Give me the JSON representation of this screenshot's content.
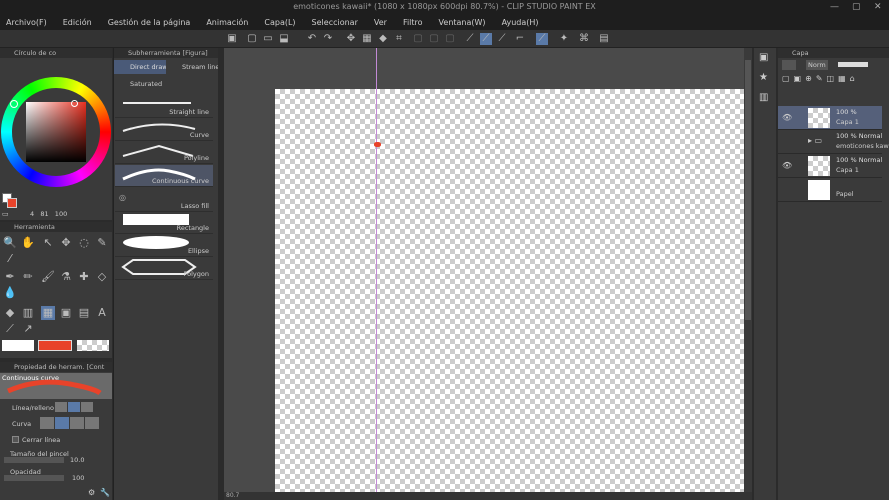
{
  "window": {
    "title": "emoticones kawaii* (1080 x 1080px 600dpi 80.7%) - CLIP STUDIO PAINT EX"
  },
  "menu": [
    "Archivo(F)",
    "Edición",
    "Gestión de la página",
    "Animación",
    "Capa(L)",
    "Seleccionar",
    "Ver",
    "Filtro",
    "Ventana(W)",
    "Ayuda(H)"
  ],
  "color_panel": {
    "tab": "Círculo de co",
    "readout": "4   81   100",
    "main_color": "#e8432a"
  },
  "subtool_panel": {
    "title": "Subherramienta [Figura]",
    "tabs": [
      "Direct draw",
      "Stream line",
      "Saturated"
    ],
    "items": [
      "Straight line",
      "Curve",
      "Polyline",
      "Continuous curve",
      "Lasso fill",
      "Rectangle",
      "Ellipse",
      "Polygon"
    ],
    "selected": "Continuous curve"
  },
  "tool_panel": {
    "title": "Herramienta"
  },
  "tool_property": {
    "title": "Propiedad de herram. [Cont",
    "preview_label": "Continuous curve",
    "line_fill": "Línea/relleno",
    "curve": "Curva",
    "close_line": "Cerrar línea",
    "brush_size_label": "Tamaño del pincel",
    "brush_size": "10.0",
    "opacity_label": "Opacidad",
    "opacity": "100"
  },
  "canvas": {
    "zoom": "80.7"
  },
  "layer_panel": {
    "title": "Capa",
    "blend": "Norm",
    "layers": [
      {
        "percent": "100 %",
        "name": "Capa 1",
        "selected": true
      },
      {
        "percent": "100 % Normal",
        "name": "emoticones kawai",
        "folder": true
      },
      {
        "percent": "100 % Normal",
        "name": "Capa 1"
      },
      {
        "percent": "",
        "name": "Papel"
      }
    ]
  }
}
